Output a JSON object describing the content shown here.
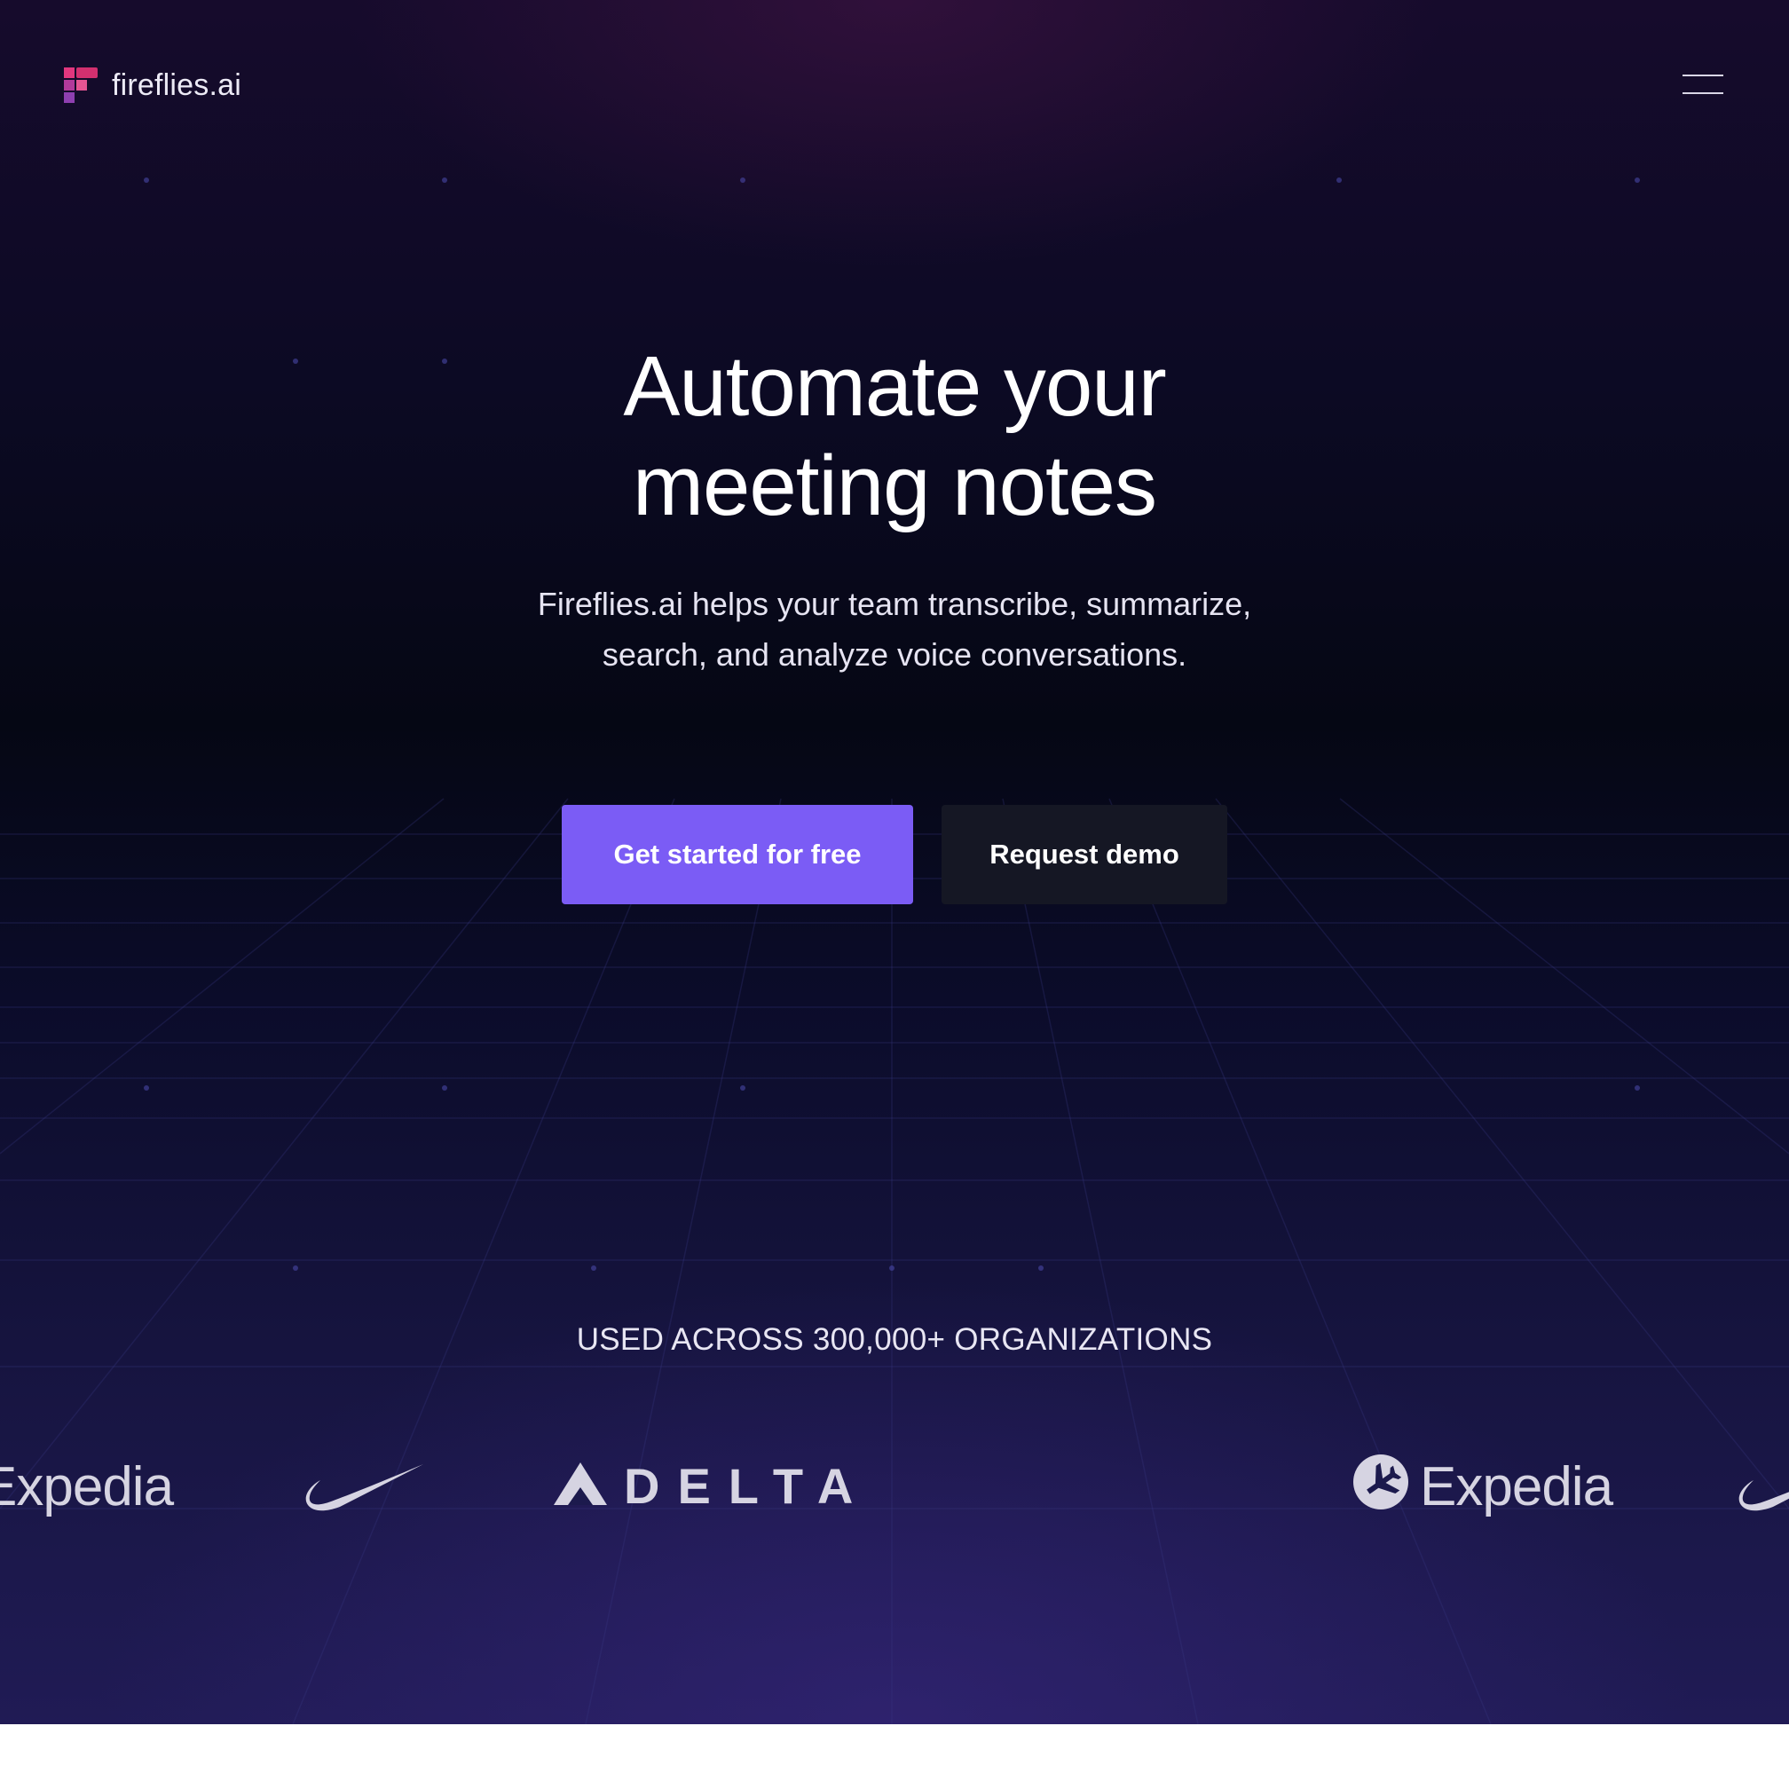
{
  "brand": {
    "name": "fireflies.ai",
    "logo_icon": "fireflies-logo-icon",
    "accent_color": "#7b5cf5"
  },
  "header": {
    "menu_icon": "hamburger-menu-icon"
  },
  "hero": {
    "headline_line1": "Automate your",
    "headline_line2": "meeting notes",
    "subhead_line1": "Fireflies.ai helps your team transcribe, summarize,",
    "subhead_line2": "search, and analyze voice conversations.",
    "primary_cta": "Get started for free",
    "secondary_cta": "Request demo"
  },
  "social_proof": {
    "caption": "USED ACROSS 300,000+ ORGANIZATIONS",
    "logos": [
      {
        "name": "Expedia",
        "icon": "expedia-logo"
      },
      {
        "name": "Nike",
        "icon": "nike-swoosh-logo"
      },
      {
        "name": "DELTA",
        "icon": "delta-logo"
      },
      {
        "name": "Expedia",
        "icon": "expedia-logo"
      },
      {
        "name": "Nike",
        "icon": "nike-swoosh-logo"
      }
    ]
  }
}
